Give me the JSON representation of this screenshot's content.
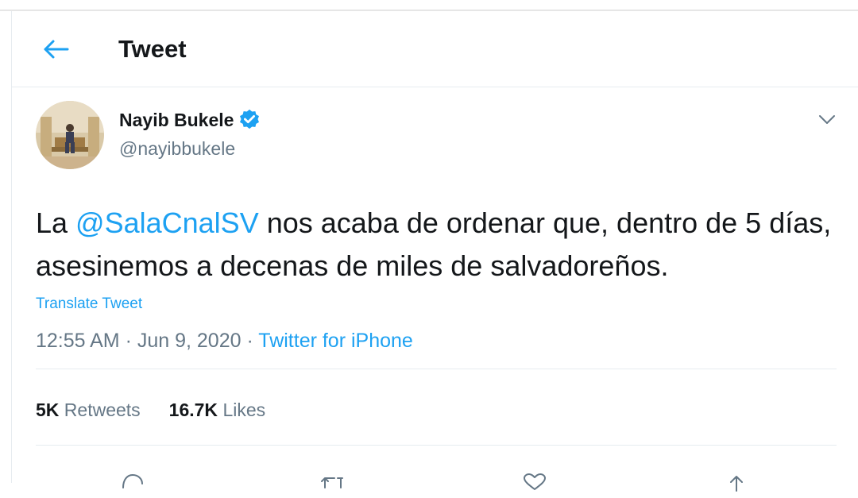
{
  "header": {
    "title": "Tweet",
    "back_icon": "back-arrow-icon"
  },
  "author": {
    "name": "Nayib Bukele",
    "handle": "@nayibbukele",
    "verified_icon": "verified-badge-icon"
  },
  "tweet": {
    "text_before": "La ",
    "mention": "@SalaCnalSV",
    "text_after": " nos acaba de ordenar que, dentro de 5 días, asesinemos a decenas de miles de salvadoreños.",
    "translate_label": "Translate Tweet"
  },
  "meta": {
    "time": "12:55 AM",
    "separator1": " · ",
    "date": "Jun 9, 2020",
    "separator2": " · ",
    "source": "Twitter for iPhone"
  },
  "stats": {
    "retweets_count": "5K",
    "retweets_label": "Retweets",
    "likes_count": "16.7K",
    "likes_label": "Likes"
  },
  "actions": [
    "reply-icon",
    "retweet-icon",
    "like-icon",
    "share-icon"
  ],
  "colors": {
    "accent": "#1da1f2",
    "text": "#14171a",
    "secondary": "#657786",
    "border": "#e6ecf0"
  }
}
